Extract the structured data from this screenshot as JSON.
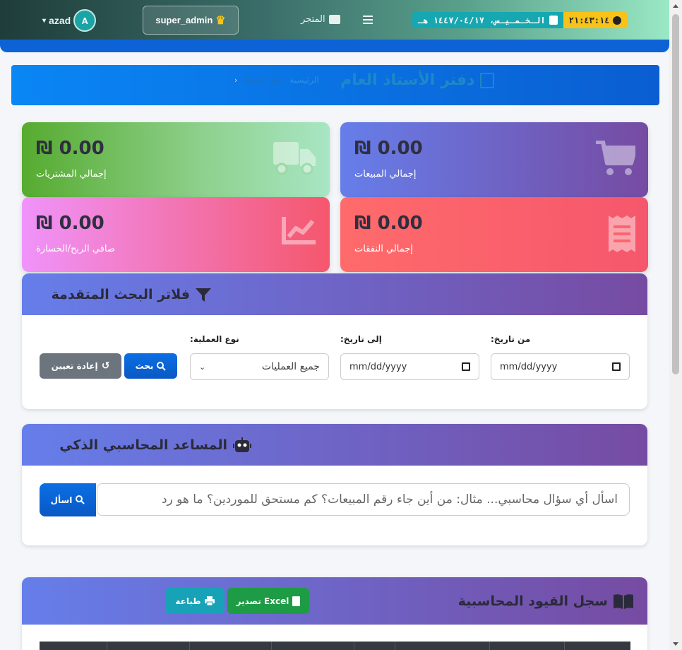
{
  "topbar": {
    "username": "azad",
    "avatar_letter": "A",
    "role": "super_admin",
    "store_label": "المتجر",
    "date_text": "الـخـمـيـس، ١٤٤٧/٠٤/١٧ هـ",
    "time_text": "٢١:٤٣:١٤",
    "colors": {
      "date_bg": "#17a7b0",
      "time_bg": "#f7c21a"
    }
  },
  "page": {
    "title": "دفتر الأستاذ العام",
    "breadcrumb": [
      "الرئيسية",
      "دفتر الأستاذ"
    ],
    "breadcrumb_sep": "›"
  },
  "stats": {
    "purchases": {
      "value": "₪ 0.00",
      "label": "إجمالي المشتريات",
      "icon": "truck-icon"
    },
    "sales": {
      "value": "₪ 0.00",
      "label": "إجمالي المبيعات",
      "icon": "cart-icon"
    },
    "profit": {
      "value": "₪ 0.00",
      "label": "صافي الربح/الخسارة",
      "icon": "chart-line-icon"
    },
    "expenses": {
      "value": "₪ 0.00",
      "label": "إجمالي النفقات",
      "icon": "receipt-icon"
    }
  },
  "filters": {
    "title": "فلاتر البحث المتقدمة",
    "from_label": "من تاريخ:",
    "from_value": "mm/dd/yyyy",
    "to_label": "إلى تاريخ:",
    "to_value": "mm/dd/yyyy",
    "type_label": "نوع العملية:",
    "type_selected": "جميع العمليات",
    "search_btn": "بحث",
    "reset_btn": "إعادة تعيين"
  },
  "assistant": {
    "title": "المساعد المحاسبي الذكي",
    "placeholder": "اسأل أي سؤال محاسبي... مثال: من أين جاء رقم المبيعات؟ كم مستحق للموردين؟ ما هو رد",
    "ask_btn": "اسأل"
  },
  "journal": {
    "title": "سجل القيود المحاسبية",
    "excel_btn": "تصدير Excel",
    "print_btn": "طباعة"
  }
}
